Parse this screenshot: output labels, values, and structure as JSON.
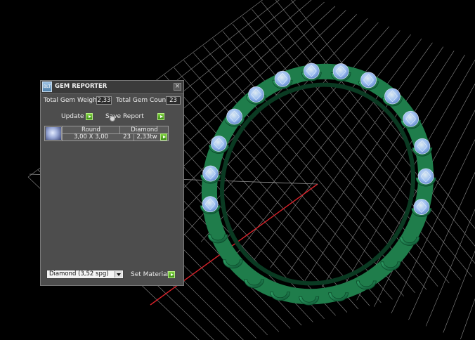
{
  "panel": {
    "title": "GEM REPORTER",
    "app_icon_text": "BLT",
    "close_glyph": "×",
    "total_gem_weight_label": "Total Gem Weight",
    "total_gem_weight_value": "2,33",
    "total_gem_count_label": "Total Gem Count",
    "total_gem_count_value": "23",
    "update_label": "Update",
    "save_report_label": "Save Report",
    "table": {
      "rows": [
        {
          "shape": "Round",
          "material": "Diamond",
          "size": "3,00 X 3,00",
          "count": "23",
          "weight": "2,33tw"
        }
      ]
    },
    "material_select_value": "Diamond     (3,52 spg)",
    "set_material_label": "Set Material"
  },
  "viewport": {
    "background": "#000000",
    "grid_color": "#8a8a8a",
    "x_axis_color": "#d8222a",
    "band_color": "#1f7d4b",
    "gem_color": "#a8c6ff"
  }
}
